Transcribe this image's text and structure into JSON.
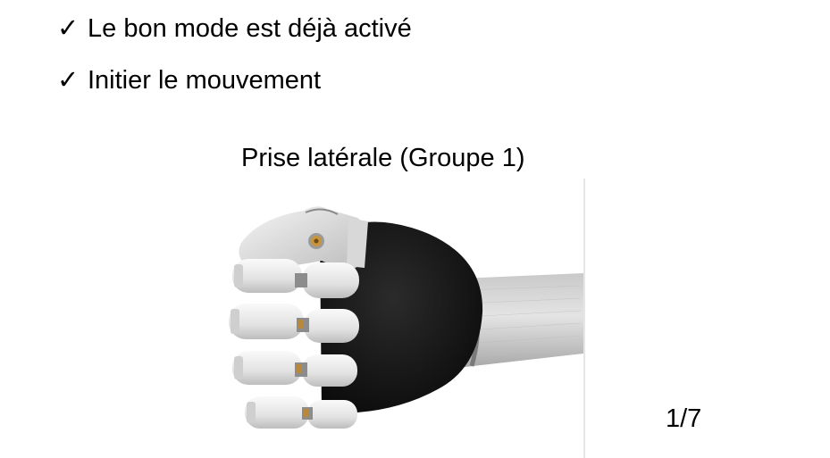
{
  "checklist": {
    "items": [
      {
        "icon": "checkmark-icon",
        "mark": "✓",
        "text": "Le bon mode est déjà activé"
      },
      {
        "icon": "checkmark-icon",
        "mark": "✓",
        "text": "Initier le mouvement"
      }
    ]
  },
  "figure": {
    "caption": "Prise latérale (Groupe 1)",
    "image": "prosthetic-hand-lateral-grip"
  },
  "pagination": {
    "counter": "1/7"
  }
}
